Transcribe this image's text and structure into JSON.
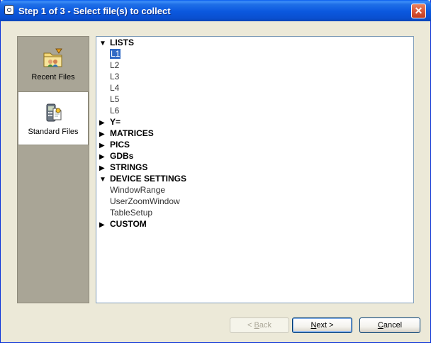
{
  "window": {
    "title": "Step 1 of 3 - Select file(s) to collect",
    "close_label": "✕"
  },
  "sidebar": {
    "items": [
      {
        "label": "Recent Files",
        "icon": "recent-files-icon",
        "selected": false
      },
      {
        "label": "Standard Files",
        "icon": "standard-files-icon",
        "selected": true
      }
    ]
  },
  "tree": {
    "expanded_glyph": "▼",
    "collapsed_glyph": "▶",
    "categories": [
      {
        "label": "LISTS",
        "expanded": true,
        "children": [
          "L1",
          "L2",
          "L3",
          "L4",
          "L5",
          "L6"
        ]
      },
      {
        "label": "Y=",
        "expanded": false
      },
      {
        "label": "MATRICES",
        "expanded": false
      },
      {
        "label": "PICS",
        "expanded": false
      },
      {
        "label": "GDBs",
        "expanded": false
      },
      {
        "label": "STRINGS",
        "expanded": false
      },
      {
        "label": "DEVICE SETTINGS",
        "expanded": true,
        "children": [
          "WindowRange",
          "UserZoomWindow",
          "TableSetup"
        ]
      },
      {
        "label": "CUSTOM",
        "expanded": false
      }
    ],
    "selected_item": "L1"
  },
  "buttons": {
    "back": {
      "prefix": "< ",
      "accel": "B",
      "rest": "ack",
      "enabled": false
    },
    "next": {
      "accel": "N",
      "rest": "ext >",
      "enabled": true
    },
    "cancel": {
      "accel": "C",
      "rest": "ancel",
      "enabled": true
    }
  },
  "colors": {
    "selection": "#316ac5",
    "title_bar": "#0b58de",
    "sidebar": "#a9a596"
  }
}
